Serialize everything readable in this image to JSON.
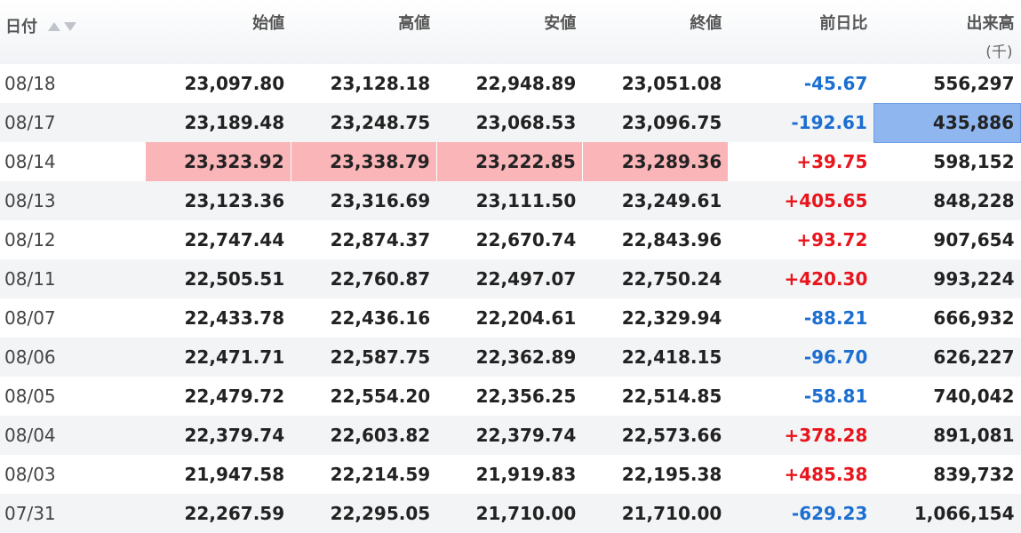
{
  "headers": {
    "date": "日付",
    "open": "始値",
    "high": "高値",
    "low": "安値",
    "close": "終値",
    "change": "前日比",
    "volume": "出来高",
    "volume_unit": "(千)"
  },
  "rows": [
    {
      "date": "08/18",
      "open": "23,097.80",
      "high": "23,128.18",
      "low": "22,948.89",
      "close": "23,051.08",
      "change": "-45.67",
      "volume": "556,297"
    },
    {
      "date": "08/17",
      "open": "23,189.48",
      "high": "23,248.75",
      "low": "23,068.53",
      "close": "23,096.75",
      "change": "-192.61",
      "volume": "435,886"
    },
    {
      "date": "08/14",
      "open": "23,323.92",
      "high": "23,338.79",
      "low": "23,222.85",
      "close": "23,289.36",
      "change": "+39.75",
      "volume": "598,152"
    },
    {
      "date": "08/13",
      "open": "23,123.36",
      "high": "23,316.69",
      "low": "23,111.50",
      "close": "23,249.61",
      "change": "+405.65",
      "volume": "848,228"
    },
    {
      "date": "08/12",
      "open": "22,747.44",
      "high": "22,874.37",
      "low": "22,670.74",
      "close": "22,843.96",
      "change": "+93.72",
      "volume": "907,654"
    },
    {
      "date": "08/11",
      "open": "22,505.51",
      "high": "22,760.87",
      "low": "22,497.07",
      "close": "22,750.24",
      "change": "+420.30",
      "volume": "993,224"
    },
    {
      "date": "08/07",
      "open": "22,433.78",
      "high": "22,436.16",
      "low": "22,204.61",
      "close": "22,329.94",
      "change": "-88.21",
      "volume": "666,932"
    },
    {
      "date": "08/06",
      "open": "22,471.71",
      "high": "22,587.75",
      "low": "22,362.89",
      "close": "22,418.15",
      "change": "-96.70",
      "volume": "626,227"
    },
    {
      "date": "08/05",
      "open": "22,479.72",
      "high": "22,554.20",
      "low": "22,356.25",
      "close": "22,514.85",
      "change": "-58.81",
      "volume": "740,042"
    },
    {
      "date": "08/04",
      "open": "22,379.74",
      "high": "22,603.82",
      "low": "22,379.74",
      "close": "22,573.66",
      "change": "+378.28",
      "volume": "891,081"
    },
    {
      "date": "08/03",
      "open": "21,947.58",
      "high": "22,214.59",
      "low": "21,919.83",
      "close": "22,195.38",
      "change": "+485.38",
      "volume": "839,732"
    },
    {
      "date": "07/31",
      "open": "22,267.59",
      "high": "22,295.05",
      "low": "21,710.00",
      "close": "21,710.00",
      "change": "-629.23",
      "volume": "1,066,154"
    }
  ],
  "highlights": {
    "price_row": "08/14",
    "volume_row": "08/17",
    "price_color": "#f9b5b8",
    "volume_color": "#8fb6ee"
  },
  "colors": {
    "positive": "#e8151c",
    "negative": "#1c6fd1"
  },
  "sort_icons": [
    "sort-ascending-icon",
    "sort-descending-icon"
  ]
}
